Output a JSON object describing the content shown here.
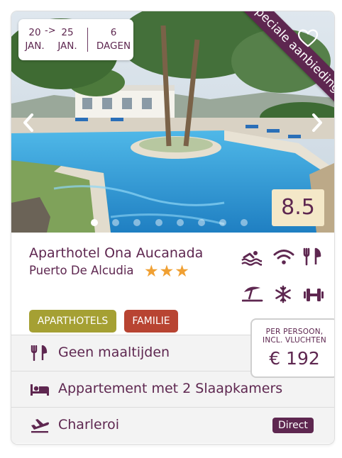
{
  "dates": {
    "start_day": "20",
    "start_month": "JAN.",
    "arrow": "->",
    "end_day": "25",
    "end_month": "JAN.",
    "duration_value": "6",
    "duration_unit": "DAGEN"
  },
  "ribbon_label": "Speciale aanbieding",
  "score": "8.5",
  "gallery": {
    "total_images": 8,
    "active_index": 0
  },
  "hotel": {
    "name": "Aparthotel Ona Aucanada",
    "location": "Puerto De Alcudia",
    "stars": 3
  },
  "amenity_icons": [
    "swimming-icon",
    "wifi-icon",
    "restaurant-icon",
    "beach-umbrella-icon",
    "air-conditioning-icon",
    "fitness-icon"
  ],
  "tags": [
    "APARTHOTELS",
    "FAMILIE"
  ],
  "price": {
    "label_line1": "PER PERSOON,",
    "label_line2": "INCL. VLUCHTEN",
    "value": "€ 192"
  },
  "details": {
    "meals": "Geen maaltijden",
    "room": "Appartement met 2 Slaapkamers",
    "airport": "Charleroi",
    "flight_badge": "Direct"
  },
  "colors": {
    "brand": "#5e2750",
    "star": "#f0a033",
    "tag_aparthotels": "#a5a033",
    "tag_familie": "#b84432",
    "score_bg": "#f4e8c8"
  }
}
